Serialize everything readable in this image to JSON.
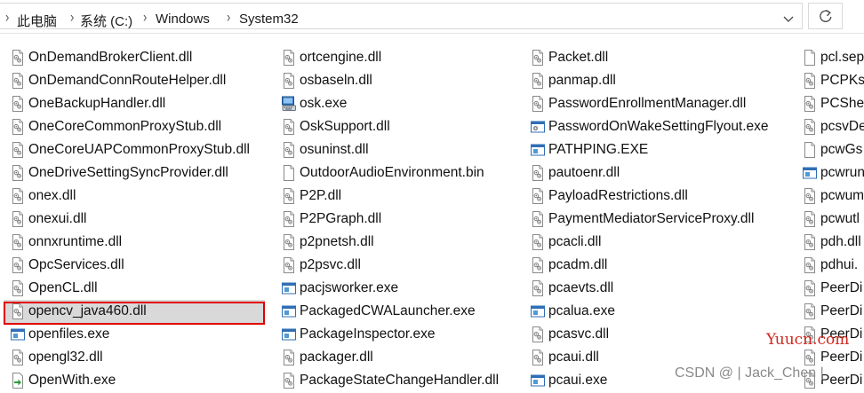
{
  "breadcrumb": {
    "items": [
      "此电脑",
      "系统 (C:)",
      "Windows",
      "System32"
    ]
  },
  "columns": [
    [
      {
        "name": "OnDemandBrokerClient.dll",
        "icon": "dll-file-icon"
      },
      {
        "name": "OnDemandConnRouteHelper.dll",
        "icon": "dll-file-icon"
      },
      {
        "name": "OneBackupHandler.dll",
        "icon": "dll-file-icon"
      },
      {
        "name": "OneCoreCommonProxyStub.dll",
        "icon": "dll-file-icon"
      },
      {
        "name": "OneCoreUAPCommonProxyStub.dll",
        "icon": "dll-file-icon"
      },
      {
        "name": "OneDriveSettingSyncProvider.dll",
        "icon": "dll-file-icon"
      },
      {
        "name": "onex.dll",
        "icon": "dll-file-icon"
      },
      {
        "name": "onexui.dll",
        "icon": "dll-file-icon"
      },
      {
        "name": "onnxruntime.dll",
        "icon": "dll-file-icon"
      },
      {
        "name": "OpcServices.dll",
        "icon": "dll-file-icon"
      },
      {
        "name": "OpenCL.dll",
        "icon": "dll-file-icon"
      },
      {
        "name": "opencv_java460.dll",
        "icon": "dll-file-icon",
        "selected": true
      },
      {
        "name": "openfiles.exe",
        "icon": "exe-window-icon"
      },
      {
        "name": "opengl32.dll",
        "icon": "dll-file-icon"
      },
      {
        "name": "OpenWith.exe",
        "icon": "openwith-arrow-icon"
      }
    ],
    [
      {
        "name": "ortcengine.dll",
        "icon": "dll-file-icon"
      },
      {
        "name": "osbaseln.dll",
        "icon": "dll-file-icon"
      },
      {
        "name": "osk.exe",
        "icon": "keyboard-icon"
      },
      {
        "name": "OskSupport.dll",
        "icon": "dll-file-icon"
      },
      {
        "name": "osuninst.dll",
        "icon": "dll-file-icon"
      },
      {
        "name": "OutdoorAudioEnvironment.bin",
        "icon": "blank-file-icon"
      },
      {
        "name": "P2P.dll",
        "icon": "dll-file-icon"
      },
      {
        "name": "P2PGraph.dll",
        "icon": "dll-file-icon"
      },
      {
        "name": "p2pnetsh.dll",
        "icon": "dll-file-icon"
      },
      {
        "name": "p2psvc.dll",
        "icon": "dll-file-icon"
      },
      {
        "name": "pacjsworker.exe",
        "icon": "exe-window-icon"
      },
      {
        "name": "PackagedCWALauncher.exe",
        "icon": "exe-window-icon"
      },
      {
        "name": "PackageInspector.exe",
        "icon": "exe-window-icon"
      },
      {
        "name": "packager.dll",
        "icon": "dll-file-icon"
      },
      {
        "name": "PackageStateChangeHandler.dll",
        "icon": "dll-file-icon"
      }
    ],
    [
      {
        "name": "Packet.dll",
        "icon": "dll-file-icon"
      },
      {
        "name": "panmap.dll",
        "icon": "dll-file-icon"
      },
      {
        "name": "PasswordEnrollmentManager.dll",
        "icon": "dll-file-icon"
      },
      {
        "name": "PasswordOnWakeSettingFlyout.exe",
        "icon": "exe-settings-icon"
      },
      {
        "name": "PATHPING.EXE",
        "icon": "exe-window-icon"
      },
      {
        "name": "pautoenr.dll",
        "icon": "dll-file-icon"
      },
      {
        "name": "PayloadRestrictions.dll",
        "icon": "dll-file-icon"
      },
      {
        "name": "PaymentMediatorServiceProxy.dll",
        "icon": "dll-file-icon"
      },
      {
        "name": "pcacli.dll",
        "icon": "dll-file-icon"
      },
      {
        "name": "pcadm.dll",
        "icon": "dll-file-icon"
      },
      {
        "name": "pcaevts.dll",
        "icon": "dll-file-icon"
      },
      {
        "name": "pcalua.exe",
        "icon": "exe-window-icon"
      },
      {
        "name": "pcasvc.dll",
        "icon": "dll-file-icon"
      },
      {
        "name": "pcaui.dll",
        "icon": "dll-file-icon"
      },
      {
        "name": "pcaui.exe",
        "icon": "exe-window-icon"
      }
    ],
    [
      {
        "name": "pcl.sep",
        "icon": "blank-file-icon"
      },
      {
        "name": "PCPKsp",
        "icon": "dll-file-icon"
      },
      {
        "name": "PCShel",
        "icon": "dll-file-icon"
      },
      {
        "name": "pcsvDe",
        "icon": "dll-file-icon"
      },
      {
        "name": "pcwGs",
        "icon": "blank-file-icon"
      },
      {
        "name": "pcwrun",
        "icon": "exe-window-icon"
      },
      {
        "name": "pcwum",
        "icon": "dll-file-icon"
      },
      {
        "name": "pcwutl",
        "icon": "dll-file-icon"
      },
      {
        "name": "pdh.dll",
        "icon": "dll-file-icon"
      },
      {
        "name": "pdhui.",
        "icon": "dll-file-icon"
      },
      {
        "name": "PeerDi",
        "icon": "dll-file-icon"
      },
      {
        "name": "PeerDi",
        "icon": "dll-file-icon"
      },
      {
        "name": "PeerDi",
        "icon": "dll-file-icon"
      },
      {
        "name": "PeerDi",
        "icon": "dll-file-icon"
      },
      {
        "name": "PeerDi",
        "icon": "dll-file-icon"
      }
    ]
  ],
  "watermarks": {
    "site": "Yuucn.com",
    "author": "CSDN @ | Jack_Chen |"
  }
}
